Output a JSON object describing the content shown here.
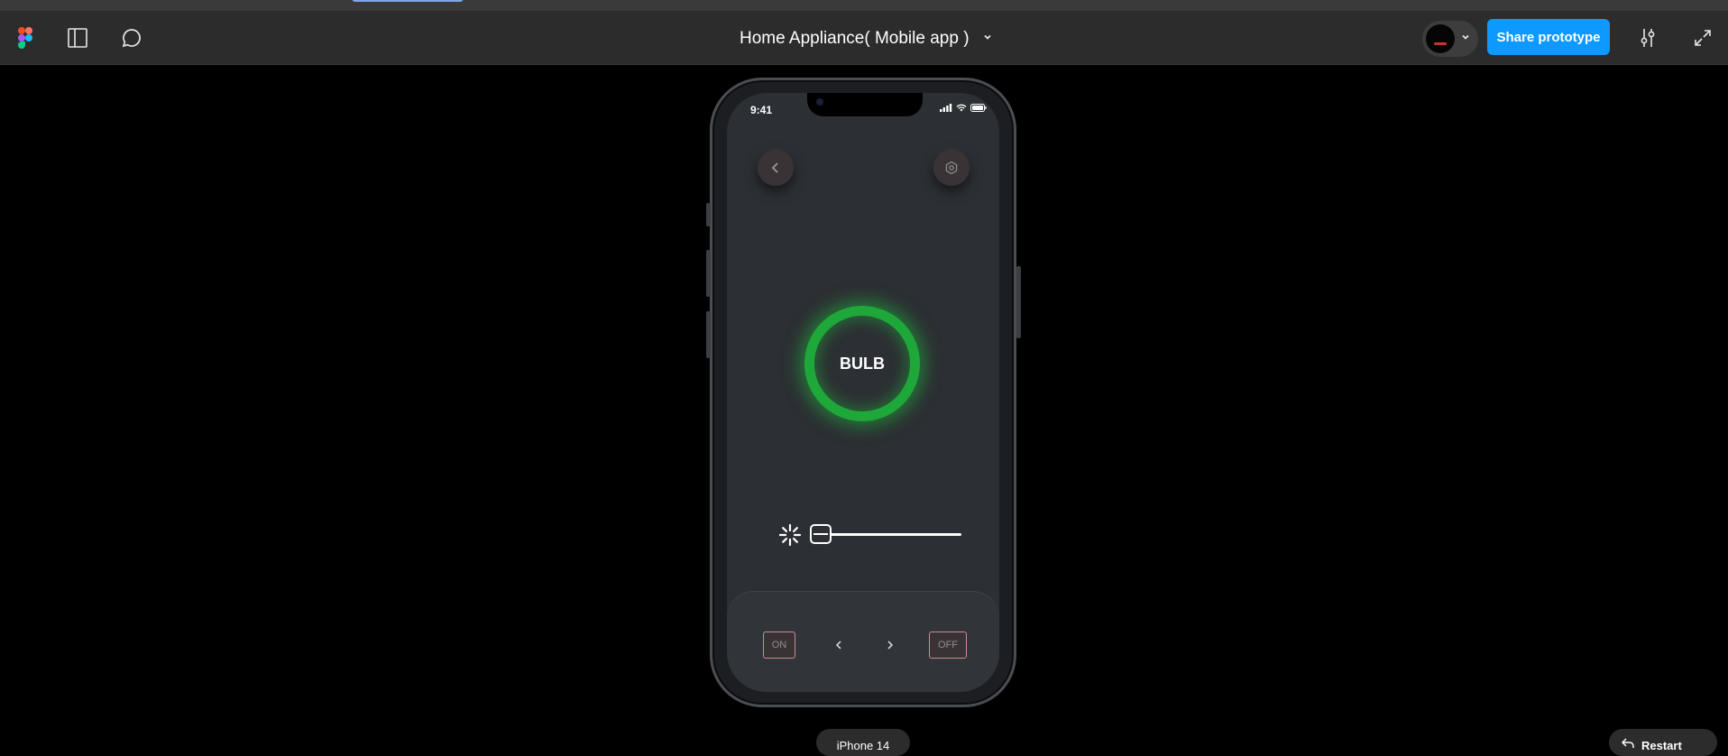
{
  "toolbar": {
    "file_title": "Home Appliance( Mobile app )",
    "share_label": "Share prototype",
    "brand_color": "#0d99ff",
    "icons": [
      "figma-logo-icon",
      "sidebar-panel-icon",
      "comment-icon",
      "chevron-down-icon",
      "settings-sliders-icon",
      "fullscreen-icon"
    ]
  },
  "phone": {
    "status_time": "9:41",
    "device_label": "iPhone 14"
  },
  "app": {
    "device_name": "BULB",
    "ring_color": "#1fa83a",
    "brightness_level": 0.0,
    "controls": {
      "on_label": "ON",
      "off_label": "OFF"
    }
  },
  "footer": {
    "restart_label": "Restart"
  }
}
